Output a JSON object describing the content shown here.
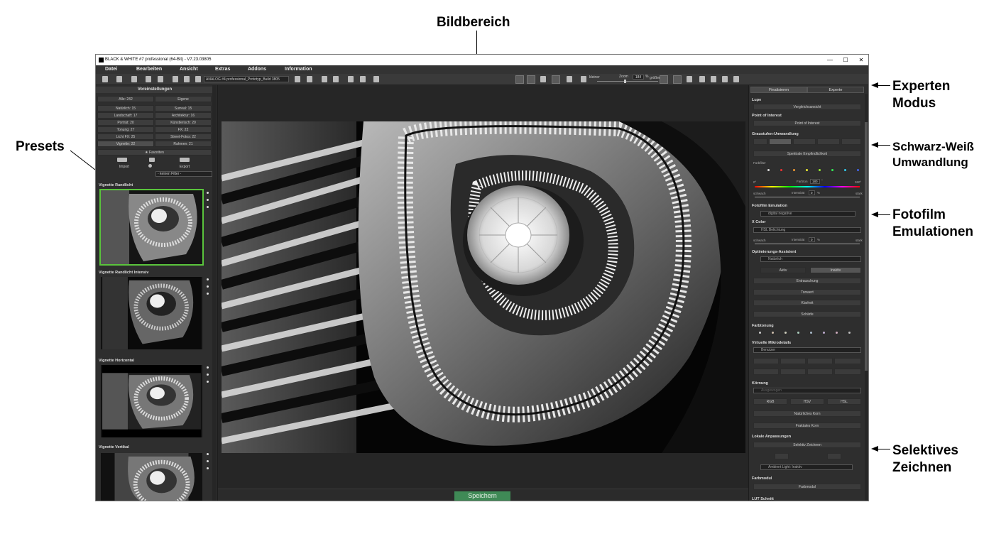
{
  "annotations": {
    "bildbereich": "Bildbereich",
    "experten_1": "Experten",
    "experten_2": "Modus",
    "presets": "Presets",
    "sw_1": "Schwarz-Weiß",
    "sw_2": "Umwandlung",
    "film_1": "Fotofilm",
    "film_2": "Emulationen",
    "sel_1": "Selektives",
    "sel_2": "Zeichnen"
  },
  "window": {
    "title": "BLACK & WHITE #7 professional (64-Bit) - V7.23.03805",
    "minimize": "—",
    "maximize": "☐",
    "close": "✕"
  },
  "menu": [
    "Datei",
    "Bearbeiten",
    "Ansicht",
    "Extras",
    "Addons",
    "Information"
  ],
  "toolbar": {
    "preset_dropdown": "ANALOG #4 professional_Prototyp_Build 3805",
    "zoom_label": "Zoom",
    "zoom_value": "184",
    "zoom_unit": "%",
    "smaller": "kleiner",
    "larger": "größer"
  },
  "left_panel": {
    "header": "Voreinstellungen",
    "all": "Alle: 242",
    "own": "Eigene",
    "categories": [
      [
        "Natürlich: 15",
        "Surreal: 15"
      ],
      [
        "Landschaft: 17",
        "Architektur: 16"
      ],
      [
        "Porträt: 20",
        "Künstlerisch: 20"
      ],
      [
        "Tonung: 27",
        "FX: 22"
      ],
      [
        "Licht FX: 25",
        "Street-Fotos: 22"
      ],
      [
        "Vignette: 22",
        "Rahmen: 21"
      ]
    ],
    "favorites": "★ Favoriten",
    "import": "Import",
    "export": "Export",
    "filter": "- keinen Filter -",
    "presets": [
      "Vignette Randlicht",
      "Vignette Randlicht Intensiv",
      "Vignette Horizontal",
      "Vignette Vertikal"
    ]
  },
  "save_button": "Speichern",
  "right_panel": {
    "tab_finish": "Finalisieren",
    "tab_expert": "Experte",
    "lupe": "Lupe",
    "compare": "Vergleichsansicht",
    "poi_head": "Point of Interest",
    "poi_btn": "Point of Interest",
    "gray_head": "Graustufen-Umwandlung",
    "spectral": "Spektrale Empfindlichkeit",
    "colorfilter": "Farbfilter",
    "hue_label": "Farbton",
    "hue_value": "180",
    "hue_unit": "°",
    "hue_min": "0°",
    "hue_max": "360°",
    "weak": "schwach",
    "strong": "stark",
    "intensity": "Intensität",
    "intensity_value": "0",
    "pct": "%",
    "film_head": "Fotofilm Emulation",
    "film_value": "digital negative",
    "xcolor_head": "X Color",
    "xcolor_value": "HSL Belichtung",
    "opt_head": "Optimierungs-Assistent",
    "opt_value": "Natürlich",
    "active": "Aktiv",
    "inactive": "Inaktiv",
    "denoise": "Entrauschung",
    "tone": "Tonwert",
    "clarity": "Klarheit",
    "sharpness": "Schärfe",
    "toning_head": "Farbtonung",
    "micro_head": "Virtuelle Mikrodetails",
    "micro_value": "Benutzer",
    "grain_head": "Körnung",
    "grain_value": "Ausgewogen",
    "rgb": "RGB",
    "hsv": "HSV",
    "hsl": "HSL",
    "natgrain": "Natürliches Korn",
    "fracgrain": "Fraktales Korn",
    "local_head": "Lokale Anpassungen",
    "selective": "Selektiv Zeichnen",
    "ambient": "Ambient Light: Inaktiv",
    "colormod_head": "Farbmodul",
    "colormod_btn": "Farbmodul",
    "lut_head": "LUT Schnitt"
  },
  "colors": {
    "accent_green": "#5ac43c",
    "save_green": "#3f8a56"
  }
}
